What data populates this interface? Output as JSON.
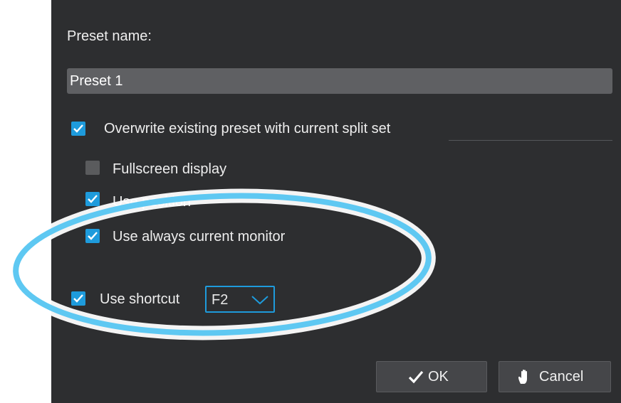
{
  "preset": {
    "label": "Preset name:",
    "value": "Preset 1"
  },
  "options": {
    "overwrite": {
      "label": "Overwrite existing preset with current split set",
      "checked": true
    },
    "fullscreen": {
      "label": "Fullscreen display",
      "checked": false
    },
    "position": {
      "label": "Use position",
      "checked": true
    },
    "current_monitor": {
      "label": "Use always current monitor",
      "checked": true
    },
    "shortcut": {
      "label": "Use shortcut",
      "checked": true,
      "value": "F2"
    }
  },
  "buttons": {
    "ok": "OK",
    "cancel": "Cancel"
  },
  "colors": {
    "accent": "#1e9bdc",
    "highlight_ring": "#5ec8f2"
  },
  "icons": {
    "ok": "checkmark-icon",
    "cancel": "hand-icon",
    "dropdown": "chevron-down-icon"
  }
}
